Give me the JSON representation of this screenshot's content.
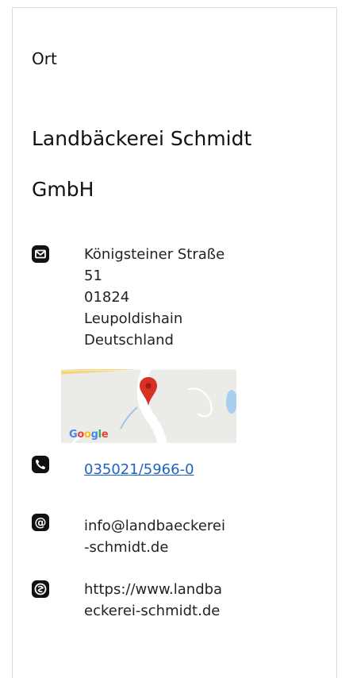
{
  "section": {
    "label": "Ort"
  },
  "company": {
    "name": "Landbäckerei Schmidt GmbH"
  },
  "address": {
    "icon": "mail-icon",
    "street": "Königsteiner Straße",
    "number": "51",
    "zip": "01824",
    "city": "Leupoldishain",
    "country": "Deutschland"
  },
  "map": {
    "provider_logo": "Google",
    "pin_color": "#d93025"
  },
  "phone": {
    "icon": "phone-icon",
    "number": "035021/5966-0",
    "link_color": "#1f63c6"
  },
  "email": {
    "icon": "at-icon",
    "line1": "info@landbaeckerei",
    "line2": "-schmidt.de"
  },
  "website": {
    "icon": "globe-icon",
    "line1": "https://www.landba",
    "line2": "eckerei-schmidt.de"
  }
}
